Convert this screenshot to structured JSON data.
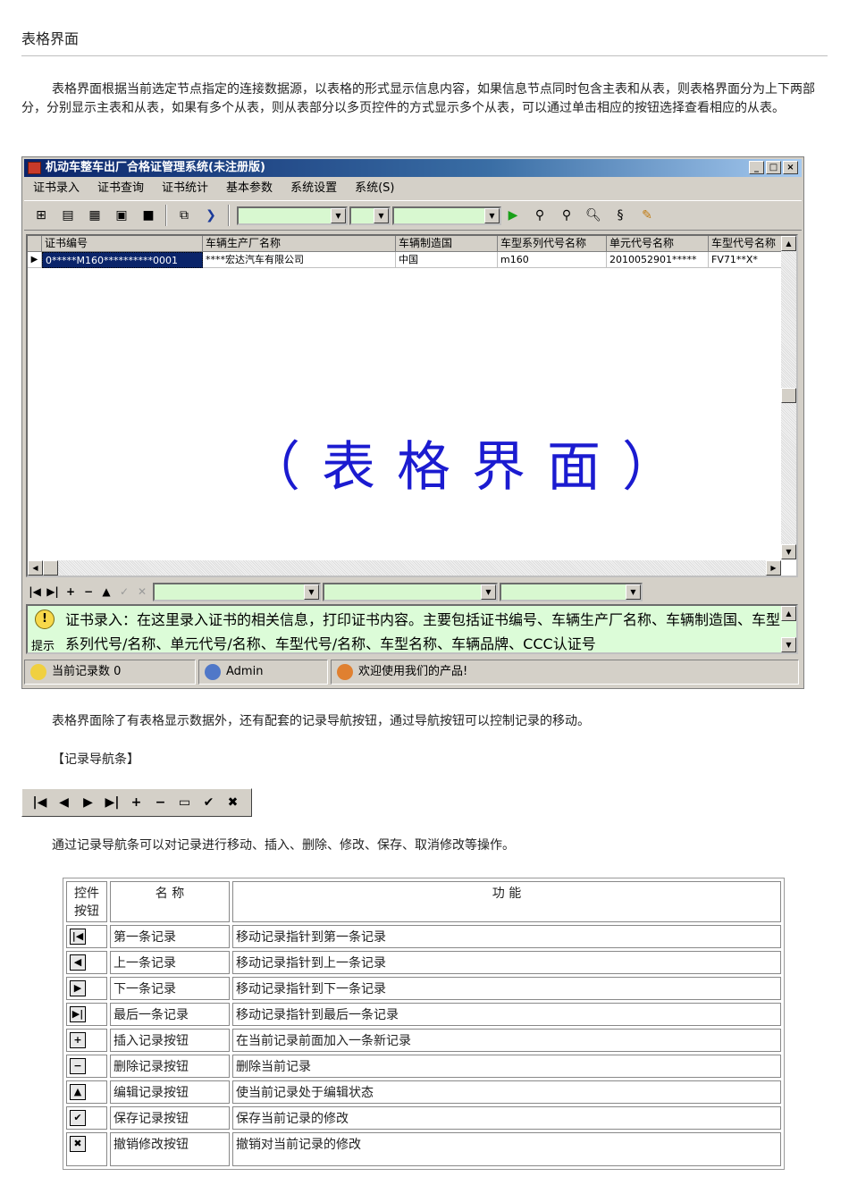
{
  "page": {
    "title": "表格界面",
    "intro": "表格界面根据当前选定节点指定的连接数据源，以表格的形式显示信息内容，如果信息节点同时包含主表和从表，则表格界面分为上下两部分，分别显示主表和从表，如果有多个从表，则从表部分以多页控件的方式显示多个从表，可以通过单击相应的按钮选择查看相应的从表。",
    "para_nav": "表格界面除了有表格显示数据外，还有配套的记录导航按钮，通过导航按钮可以控制记录的移动。",
    "nav_heading": "【记录导航条】",
    "para_ops": "通过记录导航条可以对记录进行移动、插入、删除、修改、保存、取消修改等操作。"
  },
  "app": {
    "title": "机动车整车出厂合格证管理系统(未注册版)",
    "window_buttons": [
      "_",
      "□",
      "×"
    ],
    "menu": [
      "证书录入",
      "证书查询",
      "证书统计",
      "基本参数",
      "系统设置",
      "系统(S)"
    ],
    "grid": {
      "columns": [
        "证书编号",
        "车辆生产厂名称",
        "车辆制造国",
        "车型系列代号名称",
        "单元代号名称",
        "车型代号名称"
      ],
      "rows": [
        [
          "0*****M160**********0001",
          "****宏达汽车有限公司",
          "中国",
          "m160",
          "2010052901*****",
          "FV71**X*"
        ]
      ]
    },
    "watermark": "（表格界面）",
    "hint": {
      "label": "提示",
      "text": "证书录入：在这里录入证书的相关信息，打印证书内容。主要包括证书编号、车辆生产厂名称、车辆制造国、车型系列代号/名称、单元代号/名称、车型代号/名称、车型名称、车辆品牌、CCC认证号"
    },
    "status": {
      "record_count": "当前记录数 0",
      "user": "Admin",
      "welcome": "欢迎使用我们的产品!"
    }
  },
  "function_table": {
    "headers": [
      "控件按钮",
      "名  称",
      "功        能"
    ],
    "rows": [
      {
        "icon": "first-icon",
        "glyph": "|◀",
        "name": "第一条记录",
        "func": "移动记录指针到第一条记录"
      },
      {
        "icon": "prior-icon",
        "glyph": "◀",
        "name": "上一条记录",
        "func": "移动记录指针到上一条记录"
      },
      {
        "icon": "next-icon",
        "glyph": "▶",
        "name": "下一条记录",
        "func": "移动记录指针到下一条记录"
      },
      {
        "icon": "last-icon",
        "glyph": "▶|",
        "name": "最后一条记录",
        "func": "移动记录指针到最后一条记录"
      },
      {
        "icon": "plus-icon",
        "glyph": "+",
        "name": "插入记录按钮",
        "func": "在当前记录前面加入一条新记录"
      },
      {
        "icon": "minus-icon",
        "glyph": "−",
        "name": "删除记录按钮",
        "func": "删除当前记录"
      },
      {
        "icon": "edit-icon",
        "glyph": "▲",
        "name": "编辑记录按钮",
        "func": "使当前记录处于编辑状态"
      },
      {
        "icon": "check-icon",
        "glyph": "✔",
        "name": "保存记录按钮",
        "func": "保存当前记录的修改"
      },
      {
        "icon": "cancel-icon",
        "glyph": "✖",
        "name": "撤销修改按钮",
        "func": "撤销对当前记录的修改"
      }
    ]
  }
}
